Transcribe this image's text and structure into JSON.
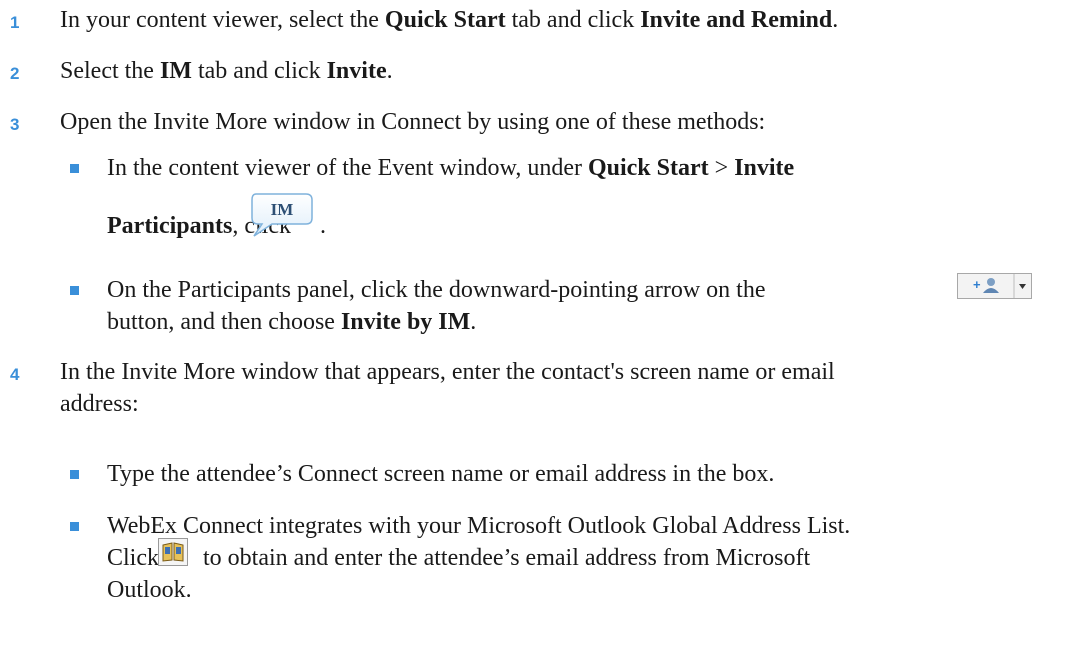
{
  "steps": [
    {
      "number": "1",
      "parts": [
        "In your content viewer, select the ",
        "Quick Start",
        " tab and click ",
        "Invite and Remind",
        "."
      ]
    },
    {
      "number": "2",
      "parts": [
        "Select the ",
        "IM",
        " tab and click ",
        "Invite",
        "."
      ]
    },
    {
      "number": "3",
      "text": "Open the Invite More window in Connect by using one of these methods:",
      "bullets": [
        {
          "parts": [
            "In the content viewer of the Event window, under ",
            "Quick Start",
            " > ",
            "Invite",
            "Participants",
            ", click ",
            "."
          ],
          "icon": "im-speech-bubble-icon",
          "icon_label": "IM"
        },
        {
          "parts": [
            "On the Participants panel, click the downward-pointing arrow on the ",
            "button, and then choose ",
            "Invite by IM",
            "."
          ],
          "icon": "add-participant-dropdown-icon"
        }
      ]
    },
    {
      "number": "4",
      "lines": [
        "In the Invite More window that appears, enter the contact's screen name or email",
        "address:"
      ],
      "bullets": [
        {
          "text": "Type the attendee’s Connect screen name or email address in the box."
        },
        {
          "line1": "WebEx Connect integrates with your Microsoft Outlook Global Address List.",
          "parts": [
            "Click ",
            " to obtain and enter the attendee’s email address from Microsoft",
            "Outlook."
          ],
          "icon": "address-book-icon"
        }
      ]
    }
  ],
  "colors": {
    "accent": "#3a8fd9",
    "text": "#1a1a1a"
  }
}
